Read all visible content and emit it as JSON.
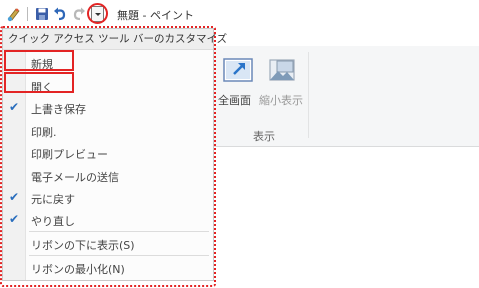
{
  "title": "無題 - ペイント",
  "qat": {
    "icons": [
      "paint-app-icon",
      "save-icon",
      "undo-icon",
      "redo-icon",
      "chevron-down-icon"
    ]
  },
  "ribbon": {
    "fullscreen": "全画面",
    "thumbnail": "縮小表示",
    "group_label": "表示"
  },
  "menu": {
    "header": "クイック アクセス ツール バーのカスタマイズ",
    "items": [
      {
        "label": "新規",
        "checked": false
      },
      {
        "label": "開く",
        "checked": false
      },
      {
        "label": "上書き保存",
        "checked": true
      },
      {
        "label": "印刷.",
        "checked": false
      },
      {
        "label": "印刷プレビュー",
        "checked": false
      },
      {
        "label": "電子メールの送信",
        "checked": false
      },
      {
        "label": "元に戻す",
        "checked": true
      },
      {
        "label": "やり直し",
        "checked": true
      },
      {
        "label": "リボンの下に表示(S)",
        "checked": false
      },
      {
        "label": "リボンの最小化(N)",
        "checked": false
      }
    ]
  },
  "colors": {
    "highlight": "#e32424",
    "check": "#2a6ebd"
  }
}
